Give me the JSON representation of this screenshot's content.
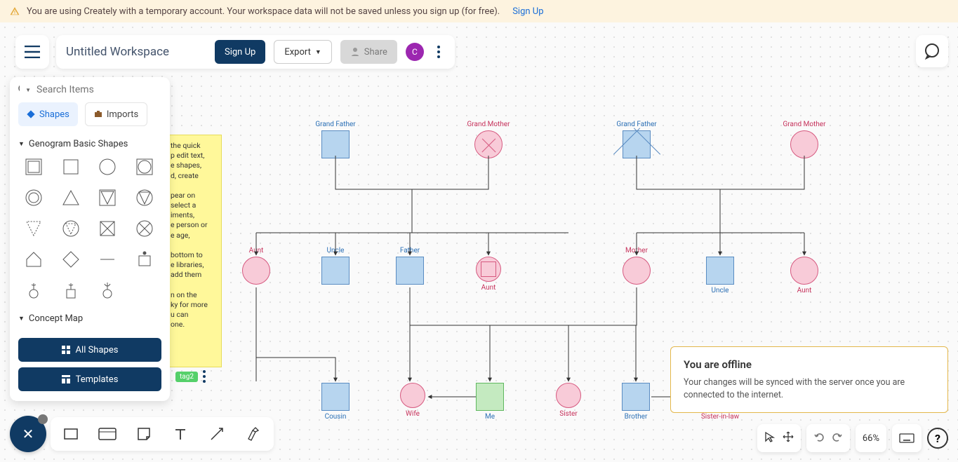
{
  "notification": {
    "text": "You are using Creately with a temporary account. Your workspace data will not be saved unless you sign up (for free).",
    "link": "Sign Up"
  },
  "topbar": {
    "title": "Untitled Workspace",
    "signup": "Sign Up",
    "export": "Export",
    "share": "Share",
    "avatar_letter": "C"
  },
  "sidepanel": {
    "search_placeholder": "Search Items",
    "tab_shapes": "Shapes",
    "tab_imports": "Imports",
    "section1": "Genogram Basic Shapes",
    "section2": "Concept Map",
    "all_shapes": "All Shapes",
    "templates": "Templates"
  },
  "sticky": {
    "line1": "the quick",
    "line2": "p edit text,",
    "line3": "e shapes,",
    "line4": "d, create",
    "line5": "pear on",
    "line6": "select a",
    "line7": "iments,",
    "line8": "e person or",
    "line9": "e age,",
    "line10": "bottom to",
    "line11": "e libraries,",
    "line12": "add them",
    "line13": "n on the",
    "line14": "ky for more",
    "line15": "u can",
    "line16": "one.",
    "tag": "tag2"
  },
  "nodes": {
    "gf1": "Grand Father",
    "gm1": "Grand Mother",
    "gf2": "Grand Father",
    "gm2": "Grand Mother",
    "aunt1": "Aunt",
    "uncle1": "Uncle",
    "father": "Father",
    "aunt_mid": "Aunt",
    "mother": "Mother",
    "uncle2": "Uncle",
    "aunt2": "Aunt",
    "cousin": "Cousin",
    "wife": "Wife",
    "me": "Me",
    "sister": "Sister",
    "brother": "Brother",
    "sil": "Sister-in-law"
  },
  "toast": {
    "title": "You are offline",
    "body": "Your changes will be synced with the server once you are connected to the internet."
  },
  "br": {
    "zoom": "66%"
  }
}
